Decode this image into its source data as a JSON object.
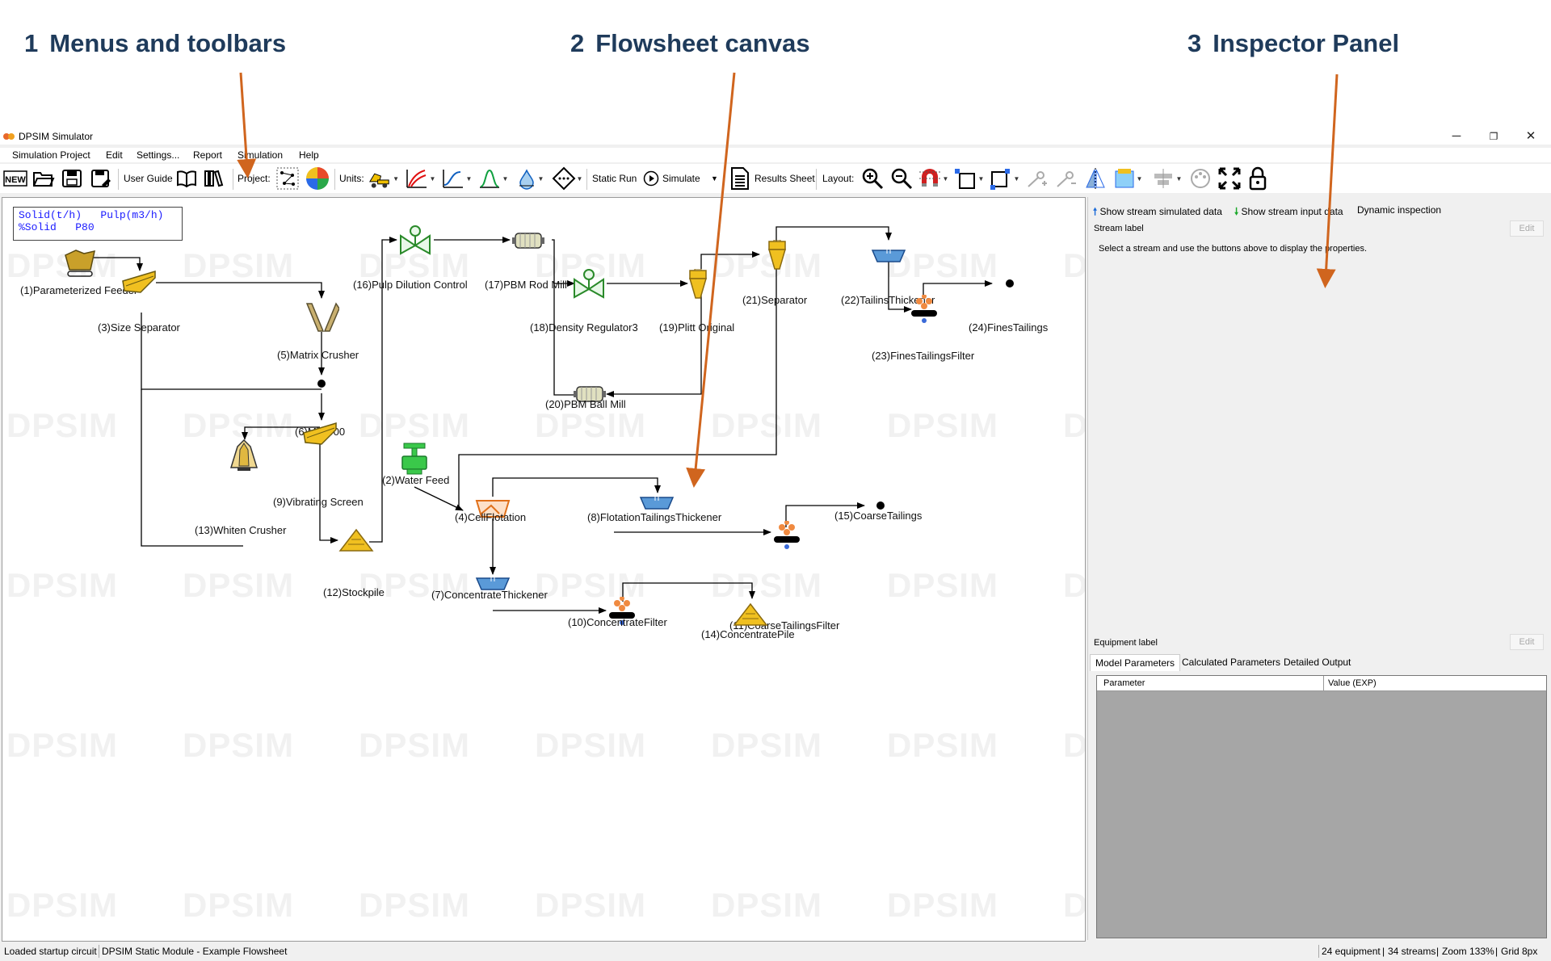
{
  "annotations": [
    {
      "num": "1",
      "text": "Menus and toolbars"
    },
    {
      "num": "2",
      "text": "Flowsheet canvas"
    },
    {
      "num": "3",
      "text": "Inspector Panel"
    }
  ],
  "window": {
    "title": "DPSIM Simulator",
    "minimize": "─",
    "maximize": "❐",
    "close": "✕"
  },
  "menu": [
    "Simulation Project",
    "Edit",
    "Settings...",
    "Report",
    "Simulation",
    "Help"
  ],
  "toolbar": {
    "user_guide": "User Guide",
    "project": "Project:",
    "units": "Units:",
    "static_run": "Static Run",
    "simulate": "Simulate",
    "results_sheet": "Results Sheet",
    "layout": "Layout:",
    "new_icon_text": "NEW"
  },
  "canvas": {
    "watermark": "DPSIM",
    "legend_line1": "Solid(t/h)   Pulp(m3/h)",
    "legend_line2": "%Solid   P80",
    "equipment": [
      {
        "id": "1",
        "label": "(1)Parameterized Feeder",
        "icon": "feeder-icon"
      },
      {
        "id": "2",
        "label": "(2)Water Feed",
        "icon": "water-feed-icon"
      },
      {
        "id": "3",
        "label": "(3)Size Separator",
        "icon": "screen-icon"
      },
      {
        "id": "4",
        "label": "(4)CellFlotation",
        "icon": "flotation-cell-icon"
      },
      {
        "id": "5",
        "label": "(5)Matrix Crusher",
        "icon": "crusher-icon"
      },
      {
        "id": "6",
        "label": "(6)Mixer00",
        "icon": "mixer-icon"
      },
      {
        "id": "7",
        "label": "(7)ConcentrateThickener",
        "icon": "thickener-icon"
      },
      {
        "id": "8",
        "label": "(8)FlotationTailingsThickener",
        "icon": "thickener-icon"
      },
      {
        "id": "9",
        "label": "(9)Vibrating Screen",
        "icon": "screen-icon"
      },
      {
        "id": "10",
        "label": "(10)ConcentrateFilter",
        "icon": "filter-icon"
      },
      {
        "id": "11",
        "label": "(11)CoarseTailingsFilter",
        "icon": "filter-icon"
      },
      {
        "id": "12",
        "label": "(12)Stockpile",
        "icon": "stockpile-icon"
      },
      {
        "id": "13",
        "label": "(13)Whiten Crusher",
        "icon": "cone-crusher-icon"
      },
      {
        "id": "14",
        "label": "(14)ConcentratePile",
        "icon": "stockpile-icon"
      },
      {
        "id": "15",
        "label": "(15)CoarseTailings",
        "icon": "product-node-icon"
      },
      {
        "id": "16",
        "label": "(16)Pulp Dilution Control",
        "icon": "valve-icon"
      },
      {
        "id": "17",
        "label": "(17)PBM Rod Mill",
        "icon": "mill-icon"
      },
      {
        "id": "18",
        "label": "(18)Density Regulator3",
        "icon": "valve-icon"
      },
      {
        "id": "19",
        "label": "(19)Plitt Original",
        "icon": "hydrocyclone-icon"
      },
      {
        "id": "20",
        "label": "(20)PBM Ball Mill",
        "icon": "mill-icon"
      },
      {
        "id": "21",
        "label": "(21)Separator",
        "icon": "hydrocyclone-icon"
      },
      {
        "id": "22",
        "label": "(22)TailinsThickener",
        "icon": "thickener-icon"
      },
      {
        "id": "23",
        "label": "(23)FinesTailingsFilter",
        "icon": "filter-icon"
      },
      {
        "id": "24",
        "label": "(24)FinesTailings",
        "icon": "product-node-icon"
      }
    ]
  },
  "inspector": {
    "show_simulated": "Show stream simulated data",
    "show_input": "Show stream input data",
    "dynamic": "Dynamic inspection",
    "stream_label": "Stream label",
    "edit": "Edit",
    "hint": "Select a stream and use the buttons above to display the properties.",
    "equipment_label": "Equipment label",
    "tabs": [
      "Model Parameters",
      "Calculated Parameters",
      "Detailed Output"
    ],
    "col_parameter": "Parameter",
    "col_value": "Value (EXP)"
  },
  "status": {
    "left1": "Loaded startup circuit",
    "left2": "DPSIM Static Module - Example Flowsheet",
    "right1": "24 equipment",
    "right2": "34 streams",
    "right3": "Zoom 133%",
    "right4": "Grid 8px"
  },
  "colors": {
    "annotation_text": "#1f3b5b",
    "annotation_arrow": "#d0651e",
    "legend_text": "#1a1aff",
    "stream_line": "#000000"
  }
}
